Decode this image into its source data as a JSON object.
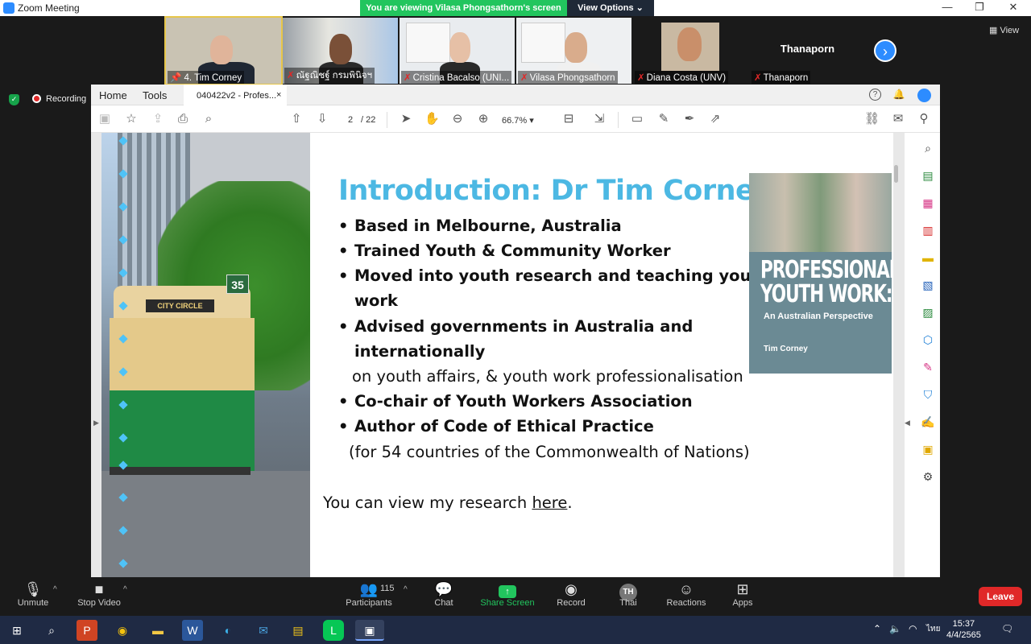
{
  "window": {
    "title": "Zoom Meeting",
    "viewing_banner": "You are viewing Vilasa Phongsathorn's screen",
    "view_options": "View Options ⌄",
    "view_label": "View"
  },
  "participants": [
    {
      "name": "4. Tim Corney",
      "pinned": true
    },
    {
      "name": "ณัฐณิชฐ์ กรมพินิจฯ",
      "muted": true
    },
    {
      "name": "Cristina Bacalso (UNI...",
      "muted": true
    },
    {
      "name": "Vilasa Phongsathorn",
      "muted": true
    },
    {
      "name": "Diana Costa (UNV)",
      "muted": true
    },
    {
      "name": "Thanaporn",
      "muted": true,
      "display": "Thanaporn"
    }
  ],
  "recording": {
    "label": "Recording"
  },
  "acrobat": {
    "tabs": {
      "home": "Home",
      "tools": "Tools",
      "document": "040422v2 - Profes...",
      "close": "×"
    },
    "toolbar": {
      "page_current": "2",
      "page_total": "/ 22",
      "zoom": "66.7%"
    }
  },
  "slide": {
    "title": "Introduction: Dr Tim Corney",
    "bullets": [
      "Based in Melbourne, Australia",
      "Trained Youth & Community Worker",
      "Moved into youth research and teaching youth",
      "work",
      "Advised governments in Australia and",
      "internationally"
    ],
    "line_affairs": "on youth affairs, & youth work professionalisation",
    "bullet_cochair": "Co-chair of Youth Workers Association",
    "bullet_author": "Author of Code of Ethical Practice",
    "line_countries": "(for 54 countries of the Commonwealth of Nations)",
    "research_text": "You can view my research ",
    "research_link": "here",
    "research_end": ".",
    "book": {
      "title_line1": "PROFESSIONAL",
      "title_line2": "YOUTH WORK:",
      "subtitle": "An Australian Perspective",
      "author": "Tim Corney"
    },
    "tram_number": "35",
    "tram_sign": "CITY CIRCLE"
  },
  "controls": {
    "unmute": "Unmute",
    "stop_video": "Stop Video",
    "participants": "Participants",
    "participant_count": "115",
    "chat": "Chat",
    "share_screen": "Share Screen",
    "record": "Record",
    "thai": "Thai",
    "thai_badge": "TH",
    "reactions": "Reactions",
    "apps": "Apps",
    "leave": "Leave"
  },
  "taskbar": {
    "lang": "ไทย",
    "time": "15:37",
    "date": "4/4/2565"
  }
}
